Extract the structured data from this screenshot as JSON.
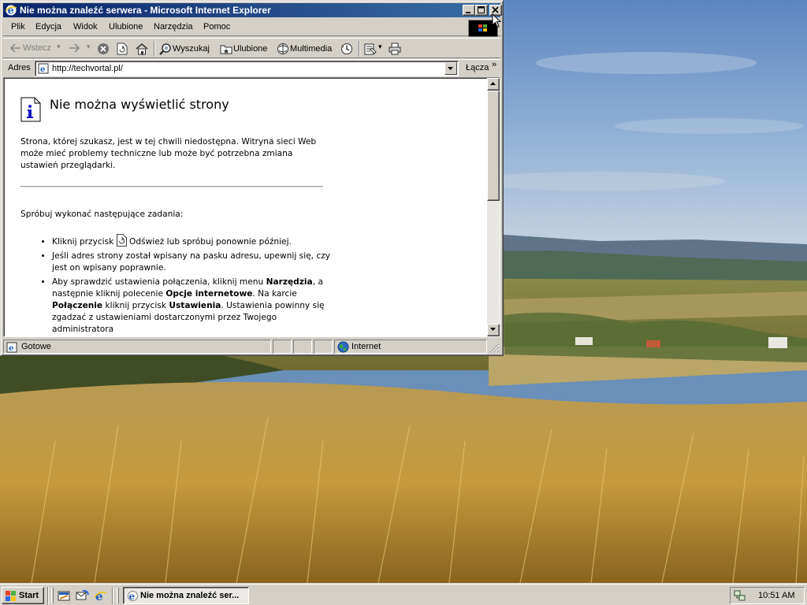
{
  "window": {
    "title": "Nie można znaleźć serwera - Microsoft Internet Explorer",
    "controls": {
      "minimize": "minimize",
      "maximize": "maximize",
      "close": "close"
    }
  },
  "menu": {
    "items": [
      {
        "label": "Plik"
      },
      {
        "label": "Edycja"
      },
      {
        "label": "Widok"
      },
      {
        "label": "Ulubione"
      },
      {
        "label": "Narzędzia"
      },
      {
        "label": "Pomoc"
      }
    ]
  },
  "toolbar": {
    "back_label": "Wstecz",
    "search_label": "Wyszukaj",
    "favorites_label": "Ulubione",
    "media_label": "Multimedia"
  },
  "address": {
    "label": "Adres",
    "value": "http://techvortal.pl/",
    "go_label": "Łącza",
    "more": "»"
  },
  "page": {
    "title": "Nie można wyświetlić strony",
    "description": "Strona, której szukasz, jest w tej chwili niedostępna. Witryna sieci Web może mieć problemy techniczne lub może być potrzebna zmiana ustawień przeglądarki.",
    "try_heading": "Spróbuj wykonać następujące zadania:",
    "tip1_before": "Kliknij przycisk",
    "tip1_after": "Odśwież lub spróbuj ponownie później.",
    "tip2": "Jeśli adres strony został wpisany na pasku adresu, upewnij się, czy jest on wpisany poprawnie.",
    "tip3_a": "Aby sprawdzić ustawienia połączenia, kliknij menu",
    "tip3_b": "Narzędzia",
    "tip3_c": ", a następnie kliknij polecenie",
    "tip3_d": "Opcje internetowe",
    "tip3_e": ". Na karcie",
    "tip3_f": "Połączenie",
    "tip3_g": "kliknij przycisk",
    "tip3_h": "Ustawienia",
    "tip3_i": ". Ustawienia powinny się zgadzać z ustawieniami dostarczonymi przez Twojego administratora"
  },
  "status": {
    "text": "Gotowe",
    "zone": "Internet"
  },
  "taskbar": {
    "start_label": "Start",
    "task_label": "Nie można znaleźć ser...",
    "clock": "10:51 AM"
  }
}
